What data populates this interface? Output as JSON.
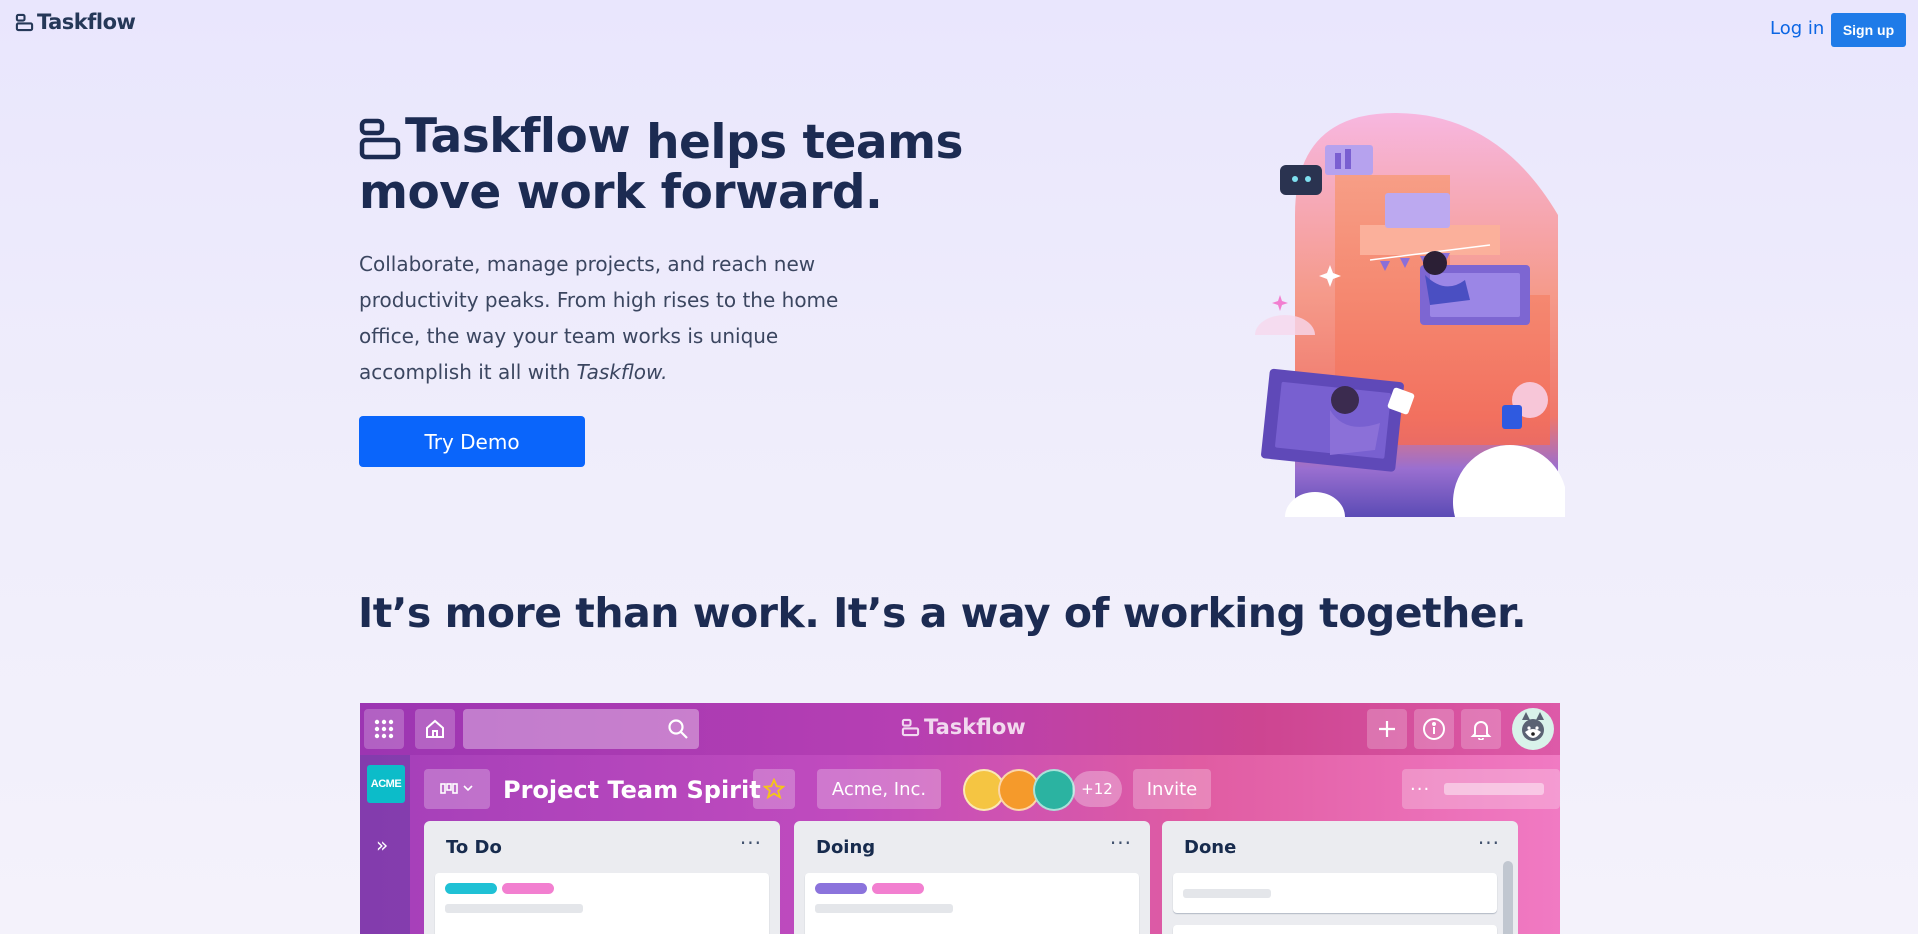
{
  "nav": {
    "logo_text": "Taskflow",
    "login": "Log in",
    "signup": "Sign up"
  },
  "hero": {
    "brand": "Taskflow",
    "title_rest": " helps teams move work forward.",
    "body": "Collaborate, manage projects, and reach new productivity peaks. From high rises to the home office, the way your team works is unique accomplish it all with ",
    "body_emph": "Taskflow.",
    "cta": "Try Demo"
  },
  "section": {
    "title": "It’s more than work. It’s a way of working together."
  },
  "board": {
    "app_name": "Taskflow",
    "workspace_badge": "ACME",
    "title": "Project Team Spirit",
    "workspace": "Acme, Inc.",
    "member_overflow": "+12",
    "invite": "Invite",
    "lists": [
      {
        "title": "To Do",
        "labels": [
          "#1fc1d5",
          "#f27fd0"
        ]
      },
      {
        "title": "Doing",
        "labels": [
          "#8b73dc",
          "#f27fd0"
        ]
      },
      {
        "title": "Done",
        "labels": []
      }
    ]
  },
  "icons": {
    "logo": "taskflow-logo-icon",
    "apps": "grid-icon",
    "home": "home-icon",
    "search": "search-icon",
    "add": "plus-icon",
    "info": "info-icon",
    "notifications": "bell-icon",
    "star": "star-icon",
    "board_switch": "board-icon",
    "more": "ellipsis-icon"
  },
  "colors": {
    "primary": "#0a65fb",
    "link": "#0c66e4",
    "heading": "#1c2b52",
    "board_gradient_start": "#a43fb9",
    "board_gradient_end": "#f17ac3",
    "star": "#f5c518"
  }
}
